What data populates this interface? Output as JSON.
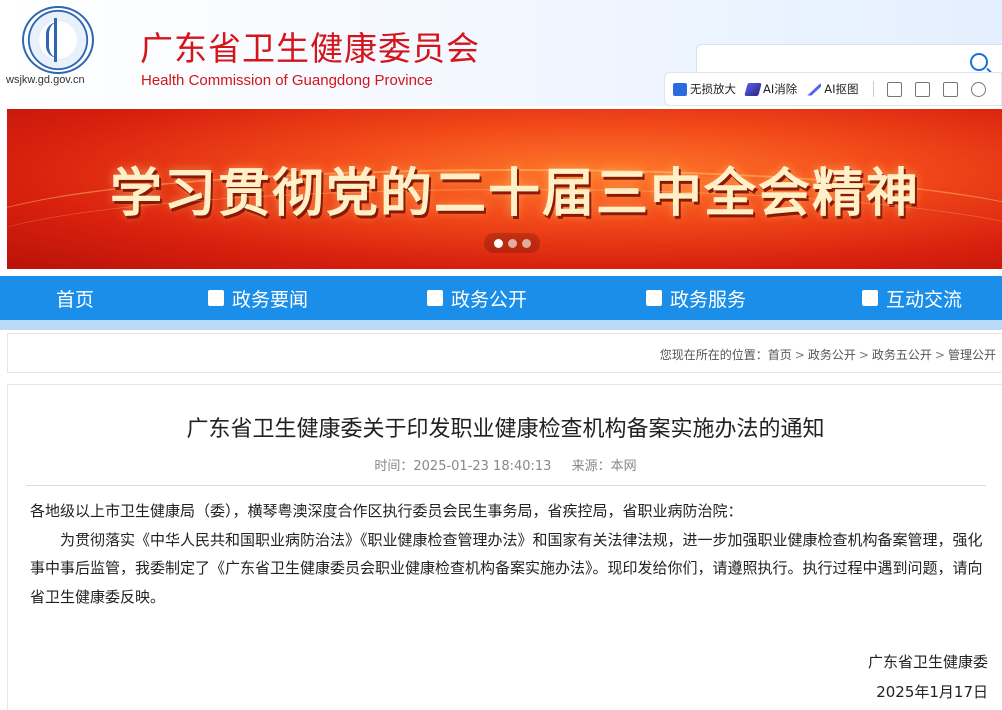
{
  "header": {
    "site_domain": "wsjkw.gd.gov.cn",
    "title_cn": "广东省卫生健康委员会",
    "title_en": "Health Commission of Guangdong Province"
  },
  "toolbar": {
    "lossless_zoom": "无损放大",
    "ai_erase": "AI消除",
    "ai_cutout": "AI抠图"
  },
  "banner": {
    "text": "学习贯彻党的二十届三中全会精神",
    "slide_count": 3,
    "active_slide": 1
  },
  "nav": {
    "items": [
      {
        "label": "首页"
      },
      {
        "label": "政务要闻"
      },
      {
        "label": "政务公开"
      },
      {
        "label": "政务服务"
      },
      {
        "label": "互动交流"
      }
    ]
  },
  "breadcrumb": {
    "prefix": "您现在所在的位置：",
    "items": [
      "首页",
      "政务公开",
      "政务五公开",
      "管理公开"
    ]
  },
  "article": {
    "title": "广东省卫生健康委关于印发职业健康检查机构备案实施办法的通知",
    "time": "时间：2025-01-23 18:40:13",
    "source": "来源：本网",
    "salutation": "各地级以上市卫生健康局（委），横琴粤澳深度合作区执行委员会民生事务局，省疾控局，省职业病防治院：",
    "body": "为贯彻落实《中华人民共和国职业病防治法》《职业健康检查管理办法》和国家有关法律法规，进一步加强职业健康检查机构备案管理，强化事中事后监管，我委制定了《广东省卫生健康委员会职业健康检查机构备案实施办法》。现印发给你们，请遵照执行。执行过程中遇到问题，请向省卫生健康委反映。",
    "signature_org": "广东省卫生健康委",
    "signature_date": "2025年1月17日"
  },
  "colors": {
    "brand_red": "#d4151c",
    "nav_blue": "#1a8ee8",
    "nav_stripe": "#b9dbf7",
    "banner_red": "#d8200e"
  }
}
